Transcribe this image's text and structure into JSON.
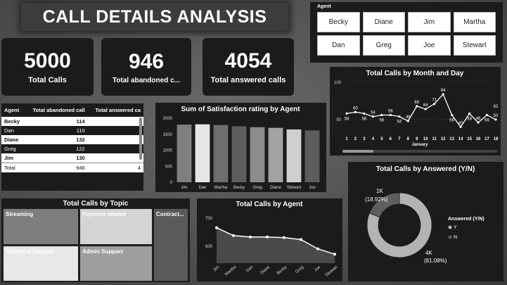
{
  "title": "CALL DETAILS ANALYSIS",
  "kpis": [
    {
      "value": "5000",
      "label": "Total Calls"
    },
    {
      "value": "946",
      "label": "Total abandoned c..."
    },
    {
      "value": "4054",
      "label": "Total answered calls"
    }
  ],
  "slicer": {
    "header": "Agent",
    "agents": [
      "Becky",
      "Diane",
      "Jim",
      "Martha",
      "Dan",
      "Greg",
      "Joe",
      "Stewart"
    ]
  },
  "table": {
    "headers": [
      "Agent",
      "Total abandoned call",
      "Total answered ca"
    ],
    "rows": [
      {
        "agent": "Becky",
        "abandoned": "114"
      },
      {
        "agent": "Dan",
        "abandoned": "110"
      },
      {
        "agent": "Diane",
        "abandoned": "132"
      },
      {
        "agent": "Greg",
        "abandoned": "122"
      },
      {
        "agent": "Jim",
        "abandoned": "130"
      }
    ],
    "total": {
      "agent": "Total",
      "abandoned": "946",
      "answered": "4"
    }
  },
  "chart_data": [
    {
      "type": "bar",
      "title": "Sum of Satisfaction rating by Agent",
      "categories": [
        "Jim",
        "Dan",
        "Martha",
        "Becky",
        "Greg",
        "Diane",
        "Stewart",
        "Joe"
      ],
      "values": [
        1800,
        1810,
        1790,
        1750,
        1720,
        1700,
        1650,
        1620
      ],
      "ylim": [
        0,
        2000
      ],
      "yticks": [
        "0",
        "500",
        "1000",
        "1500",
        "2000"
      ],
      "colors": [
        "#7f7f7f",
        "#e6e6e6",
        "#6e6e6e",
        "#5e5e5e",
        "#8c8c8c",
        "#a3a3a3",
        "#cfcfcf",
        "#5c5c5c"
      ]
    },
    {
      "type": "line",
      "title": "Total Calls by Month and Day",
      "xlabel": "January",
      "x": [
        1,
        2,
        3,
        4,
        5,
        6,
        7,
        8,
        9,
        10,
        11,
        12,
        13,
        14,
        15,
        16,
        17,
        18
      ],
      "values": [
        58,
        60,
        58,
        54,
        56,
        56,
        54,
        48,
        68,
        64,
        71,
        84,
        56,
        40,
        58,
        46,
        56,
        50
      ],
      "labels": [
        "58",
        "60",
        "58",
        "54",
        "56",
        "56",
        "54",
        "48",
        "68",
        "64",
        "71",
        "84",
        "56",
        "40",
        "58",
        "46",
        "56",
        "50"
      ],
      "ylim": [
        30,
        100
      ],
      "yticks": [
        "50",
        "100"
      ],
      "last_label": "62"
    },
    {
      "type": "pie",
      "title": "Total Calls by Answered (Y/N)",
      "slices": [
        {
          "name": "Y",
          "value": 4054,
          "label": "4K",
          "pct": "(81.08%)",
          "color": "#b3b3b3"
        },
        {
          "name": "N",
          "value": 946,
          "label": "1K",
          "pct": "(18.92%)",
          "color": "#5f5f5f"
        }
      ],
      "legend_title": "Answered (Y/N)"
    },
    {
      "type": "heatmap",
      "title": "Total Calls by Topic",
      "tiles": [
        "Streaming",
        "Payment related",
        "Contract...",
        "Technical Support",
        "Admin Support"
      ]
    },
    {
      "type": "area",
      "title": "Total Calls by Agent",
      "categories": [
        "Jim",
        "Martha",
        "Dan",
        "Diane",
        "Becky",
        "Greg",
        "Joe",
        "Stewart"
      ],
      "values": [
        666,
        638,
        633,
        633,
        631,
        624,
        591,
        572
      ],
      "ylim": [
        540,
        720
      ],
      "yticks": [
        "600",
        "700"
      ]
    }
  ]
}
